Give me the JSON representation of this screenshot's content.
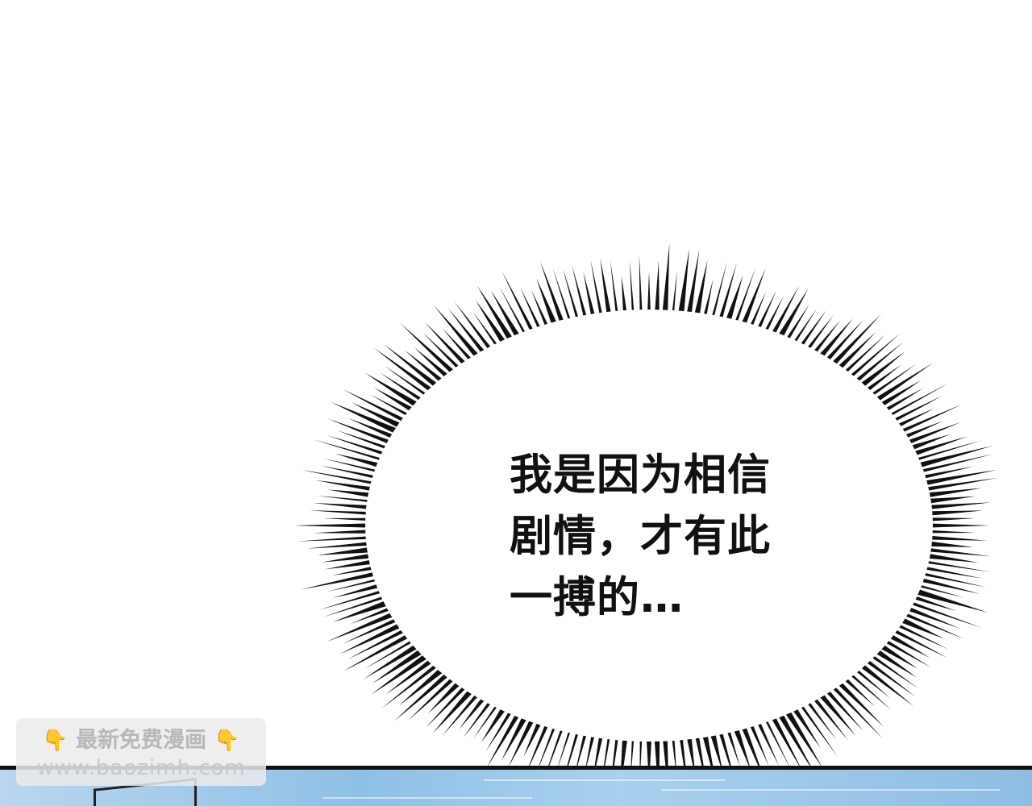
{
  "speech_bubble": {
    "lines": [
      "我是因为相信",
      "剧情，才有此",
      "一搏的…"
    ]
  },
  "watermark": {
    "hand_left": "👇",
    "title": "最新免费漫画",
    "hand_right": "👇",
    "url": "www.baozimh.com"
  },
  "colors": {
    "background": "#ffffff",
    "burst_lines": "#111111",
    "panel_sky": "#8fc0e6",
    "watermark_text": "#b8b8b8",
    "hand_icon": "#f2b12a"
  },
  "icons": {
    "hand": "pointing-down-hand-icon"
  }
}
